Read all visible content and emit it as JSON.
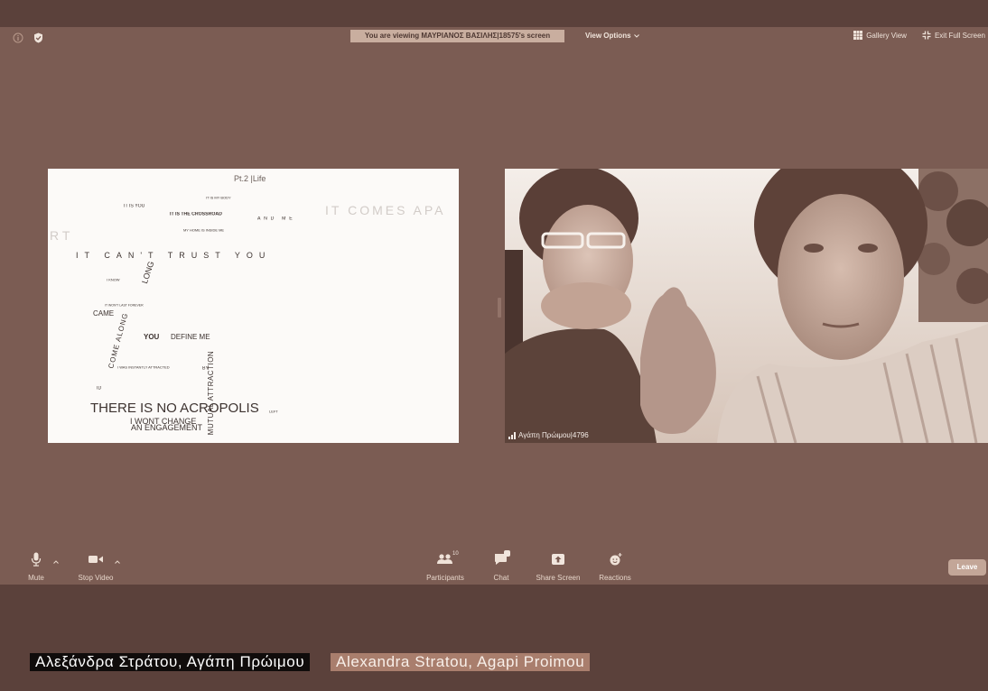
{
  "colors": {
    "frame_background": "#5b413b",
    "window_background": "#7b5c53",
    "banner_background": "#c9ae9f",
    "leave_button": "#c3a698",
    "caption_greek_background": "#100c0b",
    "caption_english_background": "#a97e6d"
  },
  "topbar": {
    "info_icon": "info-icon",
    "security_icon": "shield-icon",
    "viewing_banner": "You are viewing ΜΑΥΡΙΑΝΟΣ ΒΑΣΙΛΗΣ|18575's screen",
    "view_options_label": "View Options",
    "view_options_icon": "chevron-down-icon",
    "gallery_view_icon": "grid-icon",
    "gallery_view_label": "Gallery View",
    "exit_full_screen_icon": "exit-fullscreen-icon",
    "exit_full_screen_label": "Exit Full Screen"
  },
  "shared_screen": {
    "title": "Pt.2 |Life",
    "words": {
      "it_is_my_body": "IT IS MY BODY",
      "it_is_you": "IT IS YOU",
      "it_is_the_crossroad": "IT IS THE CROSSROAD",
      "and_me": "AND ME",
      "it_comes_apa": "IT COMES APA",
      "my_home_is_inside_me": "MY HOME IS INSIDE ME",
      "rt": "RT",
      "it_cant_trust_you": "IT CAN'T TRUST YOU",
      "long": "LONG",
      "i_know": "I KNOW",
      "it_wont_last_forever": "IT WON'T LAST FOREVER",
      "came": "CAME",
      "come_along": "COME ALONG",
      "you": "YOU",
      "define_me": "DEFINE ME",
      "i_was_instantly_attracted": "I WAS INSTANTLY ATTRACTED",
      "by": "BY",
      "mutual_attraction": "MUTUAL ATTRACTION",
      "id": "ID",
      "there_is_no_acropolis": "THERE IS NO ACROPOLIS",
      "left": "LEFT",
      "i_wont_change": "I WONT CHANGE",
      "an_engagement": "AN ENGAGEMENT"
    }
  },
  "video": {
    "signal_icon": "signal-strength-icon",
    "participant_name": "Αγάπη Πρώιμου|4796"
  },
  "toolbar": {
    "mute_icon": "microphone-icon",
    "mute_label": "Mute",
    "stop_video_icon": "camera-icon",
    "stop_video_label": "Stop Video",
    "participants_icon": "participants-icon",
    "participants_count": "10",
    "participants_label": "Participants",
    "chat_icon": "chat-icon",
    "chat_label": "Chat",
    "share_screen_icon": "share-screen-icon",
    "share_screen_label": "Share Screen",
    "reactions_icon": "reactions-icon",
    "reactions_label": "Reactions",
    "leave_label": "Leave"
  },
  "caption": {
    "greek": "Αλεξάνδρα Στράτου, Αγάπη Πρώιμου",
    "english": "Alexandra Stratou, Agapi Proimou"
  }
}
